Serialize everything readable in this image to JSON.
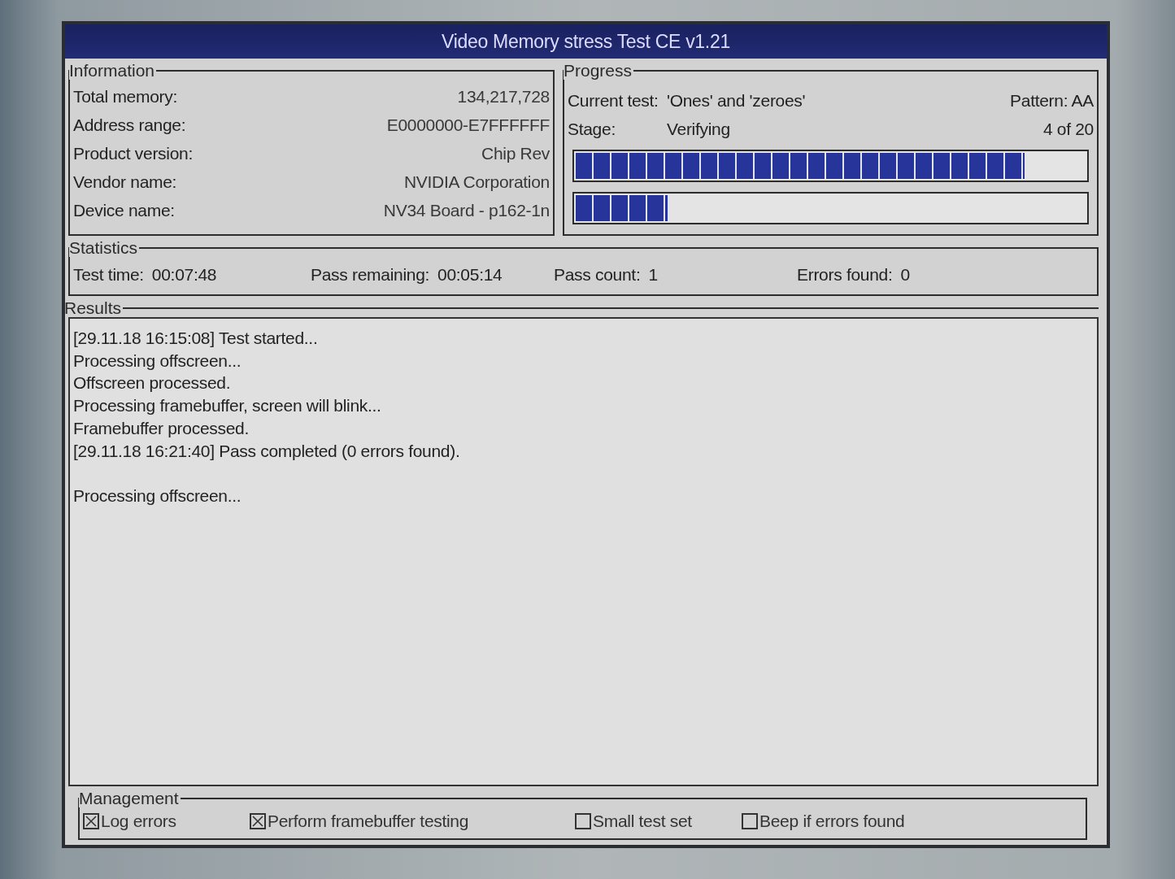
{
  "window": {
    "title": "Video Memory stress Test CE v1.21"
  },
  "information": {
    "title": "Information",
    "rows": [
      {
        "label": "Total memory:",
        "value": "134,217,728"
      },
      {
        "label": "Address range:",
        "value": "E0000000-E7FFFFFF"
      },
      {
        "label": "Product version:",
        "value": "Chip Rev"
      },
      {
        "label": "Vendor name:",
        "value": "NVIDIA Corporation"
      },
      {
        "label": "Device name:",
        "value": "NV34 Board - p162-1n"
      }
    ]
  },
  "progress": {
    "title": "Progress",
    "rows": [
      {
        "label": "Current test:",
        "value": "'Ones' and 'zeroes'",
        "right": "Pattern: AA"
      },
      {
        "label": "Stage:",
        "value": "Verifying",
        "right": "4 of 20"
      }
    ],
    "bars": [
      {
        "level": 0.88
      },
      {
        "level": 0.18
      }
    ]
  },
  "statistics": {
    "title": "Statistics",
    "items": [
      {
        "label": "Test time:",
        "value": "00:07:48"
      },
      {
        "label": "Pass remaining:",
        "value": "00:05:14"
      },
      {
        "label": "Pass count:",
        "value": "1"
      },
      {
        "label": "Errors found:",
        "value": "0"
      }
    ]
  },
  "results": {
    "title": "Results",
    "paragraphs": [
      {
        "lines": [
          "[29.11.18 16:15:08] Test started...",
          "Processing offscreen...",
          "Offscreen processed.",
          "Processing framebuffer, screen will blink...",
          "Framebuffer processed.",
          "[29.11.18 16:21:40] Pass completed (0 errors found)."
        ]
      },
      {
        "lines": [
          "Processing offscreen..."
        ]
      }
    ]
  },
  "management": {
    "title": "Management",
    "options": [
      {
        "label": "Log errors",
        "checked": true
      },
      {
        "label": "Perform framebuffer testing",
        "checked": true
      },
      {
        "label": "Small test set",
        "checked": false
      },
      {
        "label": "Beep if errors found",
        "checked": false
      }
    ]
  }
}
